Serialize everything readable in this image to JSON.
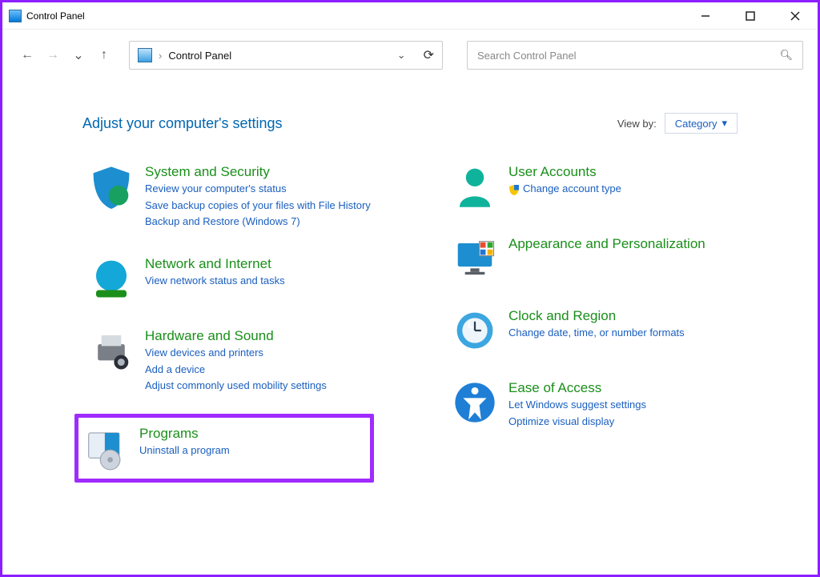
{
  "window": {
    "title": "Control Panel"
  },
  "breadcrumb": {
    "location": "Control Panel"
  },
  "search": {
    "placeholder": "Search Control Panel"
  },
  "heading": "Adjust your computer's settings",
  "viewby": {
    "label": "View by:",
    "value": "Category"
  },
  "left": [
    {
      "name": "system-security",
      "title": "System and Security",
      "links": [
        "Review your computer's status",
        "Save backup copies of your files with File History",
        "Backup and Restore (Windows 7)"
      ]
    },
    {
      "name": "network-internet",
      "title": "Network and Internet",
      "links": [
        "View network status and tasks"
      ]
    },
    {
      "name": "hardware-sound",
      "title": "Hardware and Sound",
      "links": [
        "View devices and printers",
        "Add a device",
        "Adjust commonly used mobility settings"
      ]
    },
    {
      "name": "programs",
      "title": "Programs",
      "links": [
        "Uninstall a program"
      ],
      "highlighted": true
    }
  ],
  "right": [
    {
      "name": "user-accounts",
      "title": "User Accounts",
      "links": [
        "Change account type"
      ],
      "shield": [
        true
      ]
    },
    {
      "name": "appearance",
      "title": "Appearance and Personalization",
      "links": []
    },
    {
      "name": "clock-region",
      "title": "Clock and Region",
      "links": [
        "Change date, time, or number formats"
      ]
    },
    {
      "name": "ease-of-access",
      "title": "Ease of Access",
      "links": [
        "Let Windows suggest settings",
        "Optimize visual display"
      ]
    }
  ]
}
